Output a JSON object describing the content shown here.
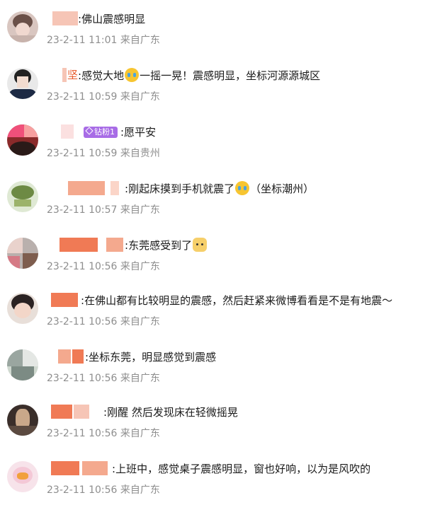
{
  "comments": [
    {
      "name_tail": "",
      "separator": ":",
      "text_parts": [
        "佛山震感明显"
      ],
      "emoji": [],
      "time": "23-2-11 11:01",
      "location": "来自广东"
    },
    {
      "name_tail": "坚",
      "separator": ":",
      "text_parts": [
        "感觉大地",
        "一摇一晃！震感明显，坐标河源源城区"
      ],
      "emoji": [
        "crying-face"
      ],
      "time": "23-2-11 10:59",
      "location": "来自广东"
    },
    {
      "name_tail": "",
      "separator": ":",
      "badge": "钻粉1",
      "text_parts": [
        "愿平安"
      ],
      "emoji": [],
      "time": "23-2-11 10:59",
      "location": "来自贵州"
    },
    {
      "name_tail": "",
      "separator": ":",
      "text_parts": [
        "刚起床摸到手机就震了",
        "（坐标潮州）"
      ],
      "emoji": [
        "crying-face"
      ],
      "time": "23-2-11 10:57",
      "location": "来自广东"
    },
    {
      "name_tail": "",
      "separator": ":",
      "text_parts": [
        "东莞感受到了",
        ""
      ],
      "emoji": [
        "dog-face"
      ],
      "time": "23-2-11 10:56",
      "location": "来自广东"
    },
    {
      "name_tail": "",
      "separator": ":",
      "text_parts": [
        "在佛山都有比较明显的震感，然后赶紧来微博看看是不是有地震～"
      ],
      "emoji": [],
      "time": "23-2-11 10:56",
      "location": "来自广东"
    },
    {
      "name_tail": "",
      "separator": ":",
      "text_parts": [
        "坐标东莞，明显感觉到震感"
      ],
      "emoji": [],
      "time": "23-2-11 10:56",
      "location": "来自广东"
    },
    {
      "name_tail": "",
      "separator": ":",
      "text_parts": [
        "刚醒 然后发现床在轻微摇晃"
      ],
      "emoji": [],
      "time": "23-2-11 10:56",
      "location": "来自广东"
    },
    {
      "name_tail": "",
      "separator": ":",
      "text_parts": [
        "上班中，感觉桌子震感明显，窗也好响，以为是风吹的"
      ],
      "emoji": [],
      "time": "23-2-11 10:56",
      "location": "来自广东"
    }
  ],
  "colors": {
    "text": "#1a1a1a",
    "meta": "#8e8e8e",
    "name_mosaic": "#f07a55",
    "badge": "#a86ce6"
  },
  "icons": [
    "crying-face-emoji",
    "dog-face-emoji",
    "diamond-icon"
  ]
}
